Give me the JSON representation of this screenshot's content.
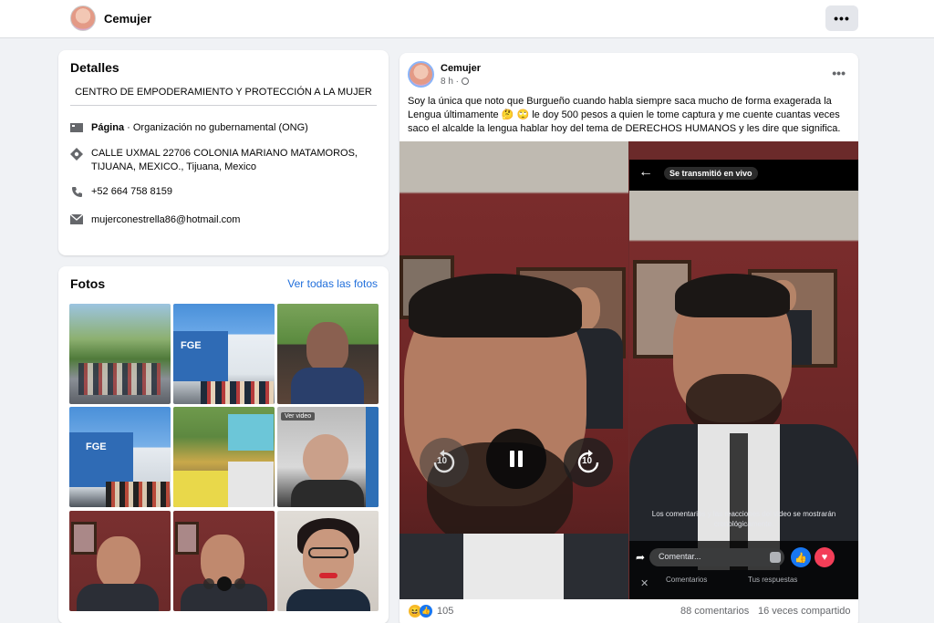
{
  "header": {
    "page_name": "Cemujer",
    "more_label": "•••"
  },
  "details": {
    "title": "Detalles",
    "bio": "CENTRO DE EMPODERAMIENTO Y PROTECCIÓN A LA MUJER",
    "category_label": "Página",
    "category_value": " · Organización no gubernamental (ONG)",
    "address": "CALLE UXMAL 22706 COLONIA MARIANO MATAMOROS, TIJUANA, MEXICO., Tijuana, Mexico",
    "phone": "+52 664 758 8159",
    "email": "mujerconestrella86@hotmail.com"
  },
  "photos": {
    "title": "Fotos",
    "see_all": "Ver todas las fotos",
    "thumb_overlay_fge": "FGE",
    "thumb_overlay_video": "Ver video"
  },
  "post": {
    "author": "Cemujer",
    "time": "8 h · ",
    "more": "•••",
    "text": "Soy la única que noto que Burgueño cuando habla siempre saca mucho de forma exagerada la Lengua últimamente 🤔 🙄 le doy 500 pesos a quien le tome captura y me cuente cuantas veces saco el alcalde la lengua hablar hoy del tema de DERECHOS HUMANOS y les dire que significa.",
    "video": {
      "live_label": "Se transmitió en vivo",
      "comments_notice": "Los comentarios y las reacciones del video se mostrarán cronológicamente.",
      "comment_placeholder": "Comentar...",
      "tab_comments": "Comentarios",
      "tab_replies": "Tus respuestas",
      "rewind_label": "10",
      "forward_label": "10"
    },
    "reactions_count": "105",
    "comments_count": "88 comentarios",
    "shares_count": "16 veces compartido"
  },
  "colors": {
    "link": "#216fdb",
    "bg": "#f0f2f5",
    "wall": "#6b2a2a"
  }
}
